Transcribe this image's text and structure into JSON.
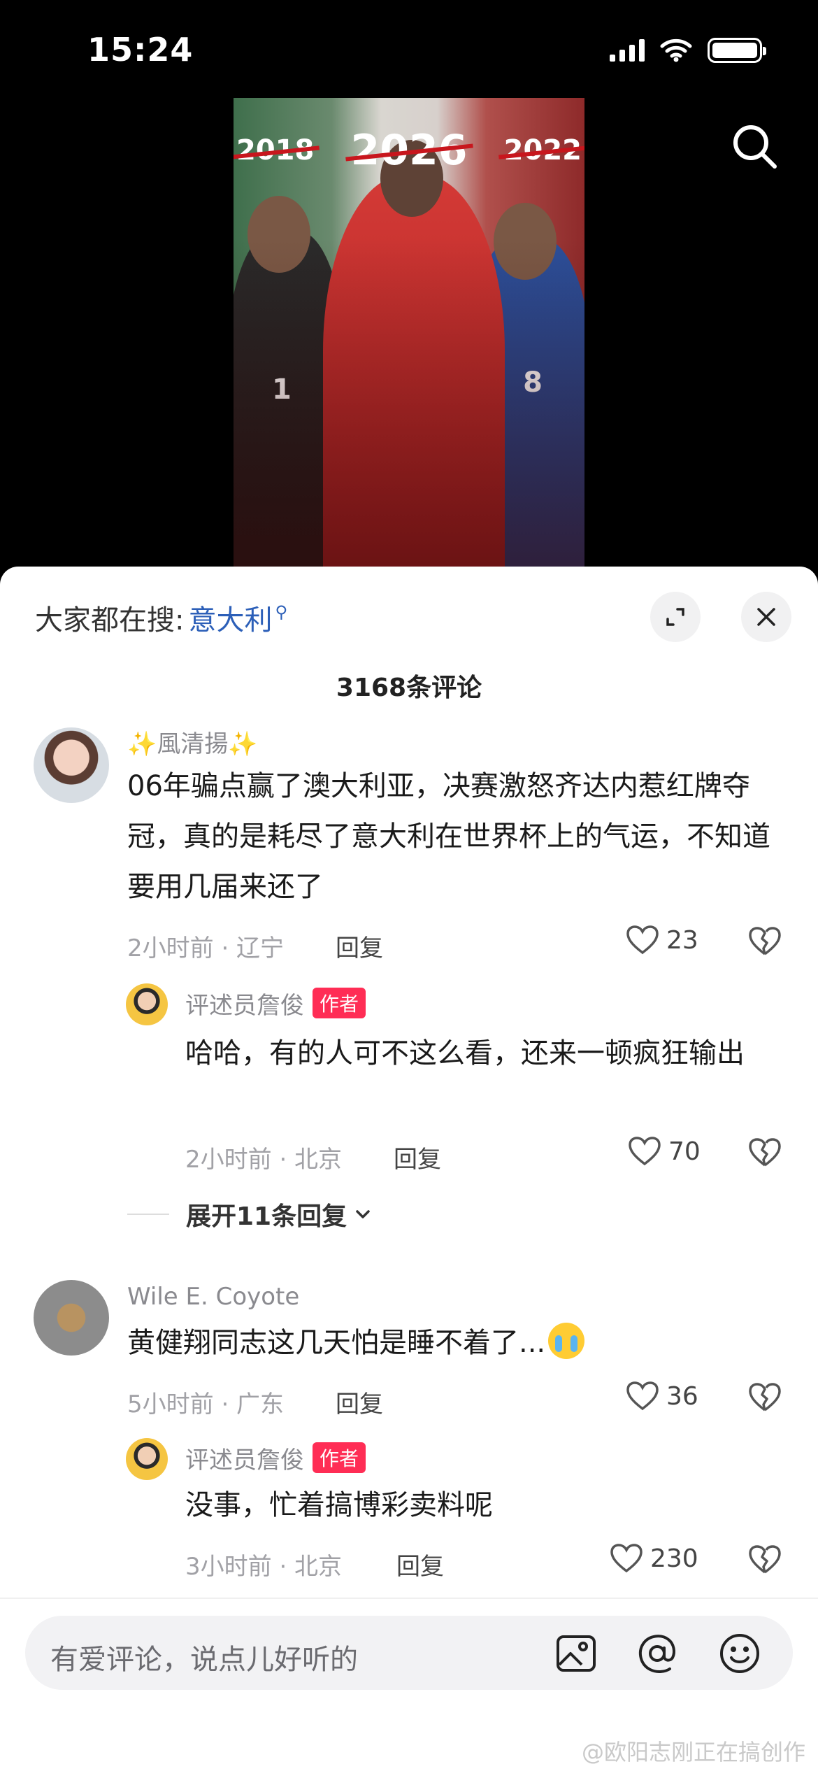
{
  "status_bar": {
    "time": "15:24"
  },
  "video": {
    "years": [
      "2018",
      "2026",
      "2022"
    ],
    "jersey_left": "1",
    "jersey_right": "8"
  },
  "sheet": {
    "hot_search_prefix": "大家都在搜:",
    "hot_search_keyword": "意大利",
    "comment_count": "3168条评论"
  },
  "comments": [
    {
      "user": "✨風清揚✨",
      "text": "06年骗点赢了澳大利亚，决赛激怒齐达内惹红牌夺冠，真的是耗尽了意大利在世界杯上的气运，不知道要用几届来还了",
      "meta": "2小时前 · 辽宁",
      "reply_label": "回复",
      "likes": "23",
      "reply": {
        "user": "评述员詹俊",
        "badge": "作者",
        "text": "哈哈，有的人可不这么看，还来一顿疯狂输出",
        "meta": "2小时前 · 北京",
        "reply_label": "回复",
        "likes": "70"
      },
      "expand_label": "展开11条回复"
    },
    {
      "user": "Wile E. Coyote",
      "text": "黄健翔同志这几天怕是睡不着了...",
      "meta": "5小时前 · 广东",
      "reply_label": "回复",
      "likes": "36",
      "reply": {
        "user": "评述员詹俊",
        "badge": "作者",
        "text": "没事，忙着搞博彩卖料呢",
        "meta": "3小时前 · 北京",
        "reply_label": "回复",
        "likes": "230"
      }
    }
  ],
  "input": {
    "placeholder": "有爱评论，说点儿好听的"
  },
  "watermark": "@欧阳志刚正在搞创作"
}
